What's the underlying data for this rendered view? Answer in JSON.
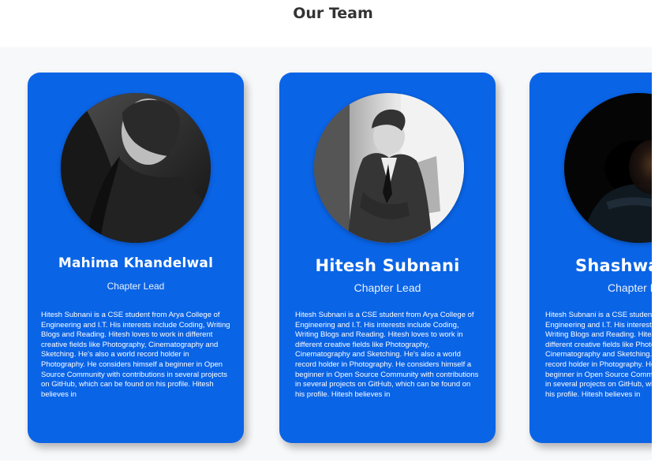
{
  "section": {
    "title": "Our Team"
  },
  "members": [
    {
      "name": "Mahima Khandelwal",
      "role": "Chapter Lead",
      "bio": "Hitesh Subnani is a CSE student from Arya College of Engineering and I.T. His interests include Coding, Writing Blogs and Reading. Hitesh loves to work in different creative fields like Photography, Cinematography and Sketching. He's also a world record holder in Photography. He considers himself a beginner in Open Source Community with contributions in several projects on GitHub, which can be found on his profile. Hitesh believes in"
    },
    {
      "name": "Hitesh Subnani",
      "role": "Chapter Lead",
      "bio": "Hitesh Subnani is a CSE student from Arya College of Engineering and I.T. His interests include Coding, Writing Blogs and Reading. Hitesh loves to work in different creative fields like Photography, Cinematography and Sketching. He's also a world record holder in Photography. He considers himself a beginner in Open Source Community with contributions in several projects on GitHub, which can be found on his profile. Hitesh believes in"
    },
    {
      "name": "Shashwat",
      "role": "Chapter Lead",
      "bio": "Hitesh Subnani is a CSE student from Arya College of Engineering and I.T. His interests include Coding, Writing Blogs and Reading. Hitesh loves to work in different creative fields like Photography, Cinematography and Sketching. He's also a world record holder in Photography. He considers himself a beginner in Open Source Community with contributions in several projects on GitHub, which can be found on his profile. Hitesh believes in"
    }
  ],
  "colors": {
    "card_background": "#0a64e6",
    "carousel_background": "#f7f8fa",
    "title_text": "#333333"
  }
}
